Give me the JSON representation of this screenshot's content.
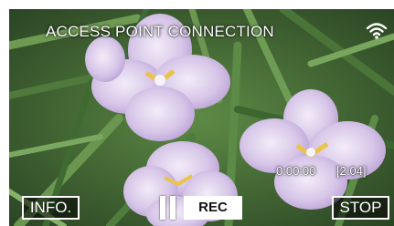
{
  "screen": {
    "title": "ACCESS POINT CONNECTION",
    "status_icon": "wifi-icon",
    "elapsed_time": "0:00:00",
    "remaining_time": "[2:04]"
  },
  "controls": {
    "info_label": "INFO.",
    "pause_icon": "pause-icon",
    "rec_label": "REC",
    "stop_label": "STOP"
  }
}
